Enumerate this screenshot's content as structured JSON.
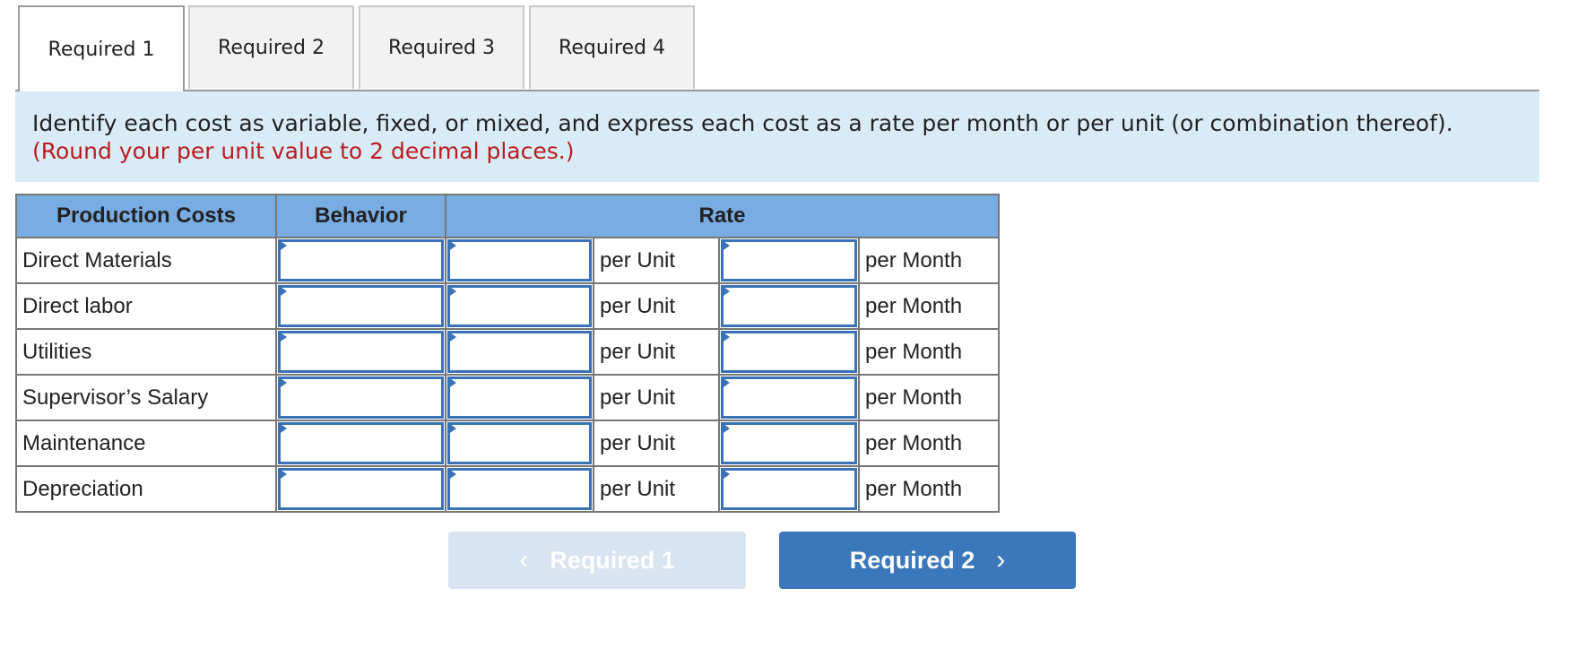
{
  "tabs": [
    {
      "label": "Required 1",
      "active": true
    },
    {
      "label": "Required 2",
      "active": false
    },
    {
      "label": "Required 3",
      "active": false
    },
    {
      "label": "Required 4",
      "active": false
    }
  ],
  "instructions": {
    "text": "Identify each cost as variable, fixed, or mixed, and express each cost as a rate per month or per unit (or combination thereof).",
    "note": "(Round your per unit value to 2 decimal places.)"
  },
  "table": {
    "headers": {
      "production_costs": "Production Costs",
      "behavior": "Behavior",
      "rate": "Rate"
    },
    "rows": [
      {
        "cost": "Direct Materials",
        "behavior": "",
        "per_unit_value": "",
        "per_unit_label": "per Unit",
        "per_month_value": "",
        "per_month_label": "per Month"
      },
      {
        "cost": "Direct labor",
        "behavior": "",
        "per_unit_value": "",
        "per_unit_label": "per Unit",
        "per_month_value": "",
        "per_month_label": "per Month"
      },
      {
        "cost": "Utilities",
        "behavior": "",
        "per_unit_value": "",
        "per_unit_label": "per Unit",
        "per_month_value": "",
        "per_month_label": "per Month"
      },
      {
        "cost": "Supervisor’s Salary",
        "behavior": "",
        "per_unit_value": "",
        "per_unit_label": "per Unit",
        "per_month_value": "",
        "per_month_label": "per Month"
      },
      {
        "cost": "Maintenance",
        "behavior": "",
        "per_unit_value": "",
        "per_unit_label": "per Unit",
        "per_month_value": "",
        "per_month_label": "per Month"
      },
      {
        "cost": "Depreciation",
        "behavior": "",
        "per_unit_value": "",
        "per_unit_label": "per Unit",
        "per_month_value": "",
        "per_month_label": "per Month"
      }
    ]
  },
  "nav": {
    "prev_label": "Required 1",
    "next_label": "Required 2",
    "prev_icon": "chevron-left-icon",
    "next_icon": "chevron-right-icon",
    "prev_glyph": "‹",
    "next_glyph": "›"
  },
  "colors": {
    "header_bg": "#79ace3",
    "info_bg": "#daebf8",
    "note_red": "#b91c1c",
    "input_border": "#3a72b8",
    "next_button": "#3a77bb",
    "prev_button_disabled": "#d8e4f1"
  }
}
